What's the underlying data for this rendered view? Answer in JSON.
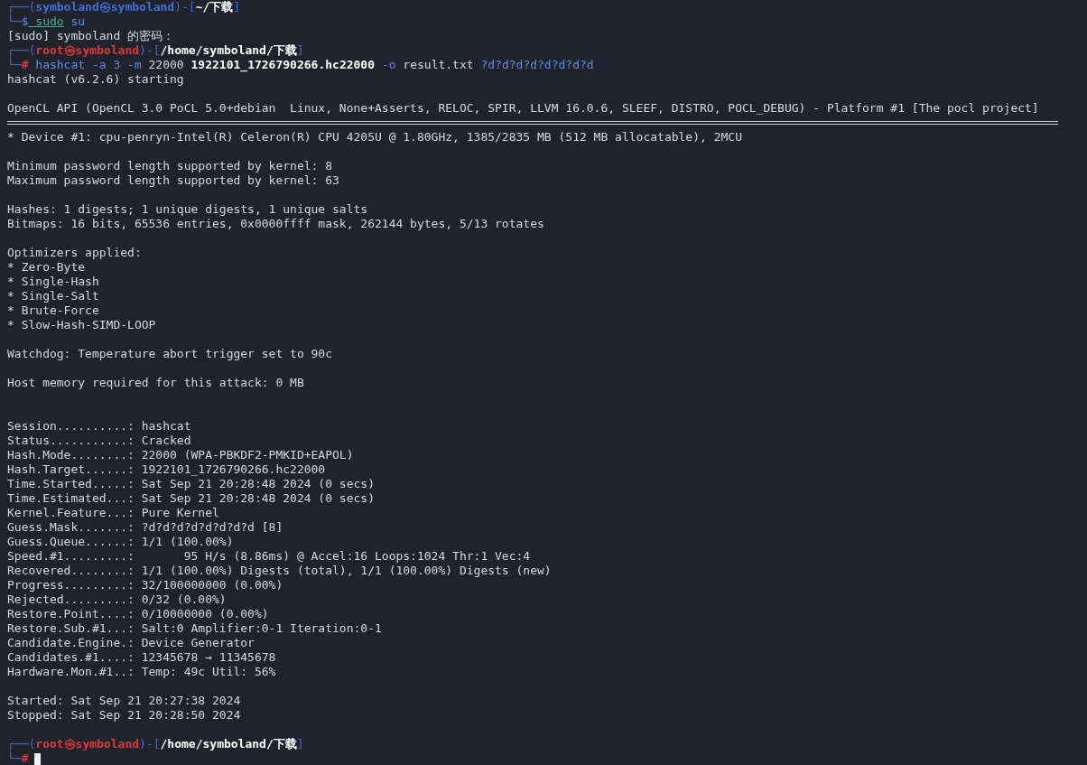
{
  "terminal": {
    "lines": [
      {
        "kind": "prompt",
        "segments": [
          {
            "text": "┌──(",
            "kind": "frame"
          },
          {
            "text": "symboland㉿symboland",
            "kind": "user"
          },
          {
            "text": ")-[",
            "kind": "frame"
          },
          {
            "text": "~/下载",
            "kind": "path"
          },
          {
            "text": "]",
            "kind": "frame"
          }
        ]
      },
      {
        "kind": "prompt",
        "segments": [
          {
            "text": "└─",
            "kind": "frame"
          },
          {
            "text": "$",
            "kind": "user"
          },
          {
            "text": " sudo",
            "kind": "underlined"
          },
          {
            "text": " su",
            "kind": "command"
          }
        ]
      },
      {
        "kind": "output",
        "segments": [
          {
            "text": "[sudo] symboland 的密码：",
            "kind": "plain"
          }
        ]
      },
      {
        "kind": "prompt",
        "segments": [
          {
            "text": "┌──(",
            "kind": "frame"
          },
          {
            "text": "root㉿symboland",
            "kind": "root"
          },
          {
            "text": ")-[",
            "kind": "frame"
          },
          {
            "text": "/home/symboland/下载",
            "kind": "path"
          },
          {
            "text": "]",
            "kind": "frame"
          }
        ]
      },
      {
        "kind": "prompt",
        "segments": [
          {
            "text": "└─",
            "kind": "frame"
          },
          {
            "text": "#",
            "kind": "root"
          },
          {
            "text": " hashcat -a 3 -m ",
            "kind": "command"
          },
          {
            "text": "22000 ",
            "kind": "plain"
          },
          {
            "text": "1922101_1726790266.hc22000",
            "kind": "bold"
          },
          {
            "text": " -o ",
            "kind": "command"
          },
          {
            "text": "result.txt ",
            "kind": "plain"
          },
          {
            "text": "?d?d?d?d?d?d?d?d",
            "kind": "command"
          }
        ]
      },
      {
        "kind": "output",
        "segments": [
          {
            "text": "hashcat (v6.2.6) starting",
            "kind": "plain"
          }
        ]
      },
      {
        "kind": "blank"
      },
      {
        "kind": "output",
        "segments": [
          {
            "text": "OpenCL API (OpenCL 3.0 PoCL 5.0+debian  Linux, None+Asserts, RELOC, SPIR, LLVM 16.0.6, SLEEF, DISTRO, POCL_DEBUG) - Platform #1 [The pocl project]",
            "kind": "plain"
          }
        ]
      },
      {
        "kind": "rule"
      },
      {
        "kind": "output",
        "segments": [
          {
            "text": "* Device #1: cpu-penryn-Intel(R) Celeron(R) CPU 4205U @ 1.80GHz, 1385/2835 MB (512 MB allocatable), 2MCU",
            "kind": "plain"
          }
        ]
      },
      {
        "kind": "blank"
      },
      {
        "kind": "output",
        "segments": [
          {
            "text": "Minimum password length supported by kernel: 8",
            "kind": "plain"
          }
        ]
      },
      {
        "kind": "output",
        "segments": [
          {
            "text": "Maximum password length supported by kernel: 63",
            "kind": "plain"
          }
        ]
      },
      {
        "kind": "blank"
      },
      {
        "kind": "output",
        "segments": [
          {
            "text": "Hashes: 1 digests; 1 unique digests, 1 unique salts",
            "kind": "plain"
          }
        ]
      },
      {
        "kind": "output",
        "segments": [
          {
            "text": "Bitmaps: 16 bits, 65536 entries, 0x0000ffff mask, 262144 bytes, 5/13 rotates",
            "kind": "plain"
          }
        ]
      },
      {
        "kind": "blank"
      },
      {
        "kind": "output",
        "segments": [
          {
            "text": "Optimizers applied:",
            "kind": "plain"
          }
        ]
      },
      {
        "kind": "output",
        "segments": [
          {
            "text": "* Zero-Byte",
            "kind": "plain"
          }
        ]
      },
      {
        "kind": "output",
        "segments": [
          {
            "text": "* Single-Hash",
            "kind": "plain"
          }
        ]
      },
      {
        "kind": "output",
        "segments": [
          {
            "text": "* Single-Salt",
            "kind": "plain"
          }
        ]
      },
      {
        "kind": "output",
        "segments": [
          {
            "text": "* Brute-Force",
            "kind": "plain"
          }
        ]
      },
      {
        "kind": "output",
        "segments": [
          {
            "text": "* Slow-Hash-SIMD-LOOP",
            "kind": "plain"
          }
        ]
      },
      {
        "kind": "blank"
      },
      {
        "kind": "output",
        "segments": [
          {
            "text": "Watchdog: Temperature abort trigger set to 90c",
            "kind": "plain"
          }
        ]
      },
      {
        "kind": "blank"
      },
      {
        "kind": "output",
        "segments": [
          {
            "text": "Host memory required for this attack: 0 MB",
            "kind": "plain"
          }
        ]
      },
      {
        "kind": "blank"
      },
      {
        "kind": "blank"
      },
      {
        "kind": "output",
        "segments": [
          {
            "text": "Session..........: hashcat",
            "kind": "plain"
          }
        ]
      },
      {
        "kind": "output",
        "segments": [
          {
            "text": "Status...........: Cracked",
            "kind": "plain"
          }
        ]
      },
      {
        "kind": "output",
        "segments": [
          {
            "text": "Hash.Mode........: 22000 (WPA-PBKDF2-PMKID+EAPOL)",
            "kind": "plain"
          }
        ]
      },
      {
        "kind": "output",
        "segments": [
          {
            "text": "Hash.Target......: 1922101_1726790266.hc22000",
            "kind": "plain"
          }
        ]
      },
      {
        "kind": "output",
        "segments": [
          {
            "text": "Time.Started.....: Sat Sep 21 20:28:48 2024 (0 secs)",
            "kind": "plain"
          }
        ]
      },
      {
        "kind": "output",
        "segments": [
          {
            "text": "Time.Estimated...: Sat Sep 21 20:28:48 2024 (0 secs)",
            "kind": "plain"
          }
        ]
      },
      {
        "kind": "output",
        "segments": [
          {
            "text": "Kernel.Feature...: Pure Kernel",
            "kind": "plain"
          }
        ]
      },
      {
        "kind": "output",
        "segments": [
          {
            "text": "Guess.Mask.......: ?d?d?d?d?d?d?d?d [8]",
            "kind": "plain"
          }
        ]
      },
      {
        "kind": "output",
        "segments": [
          {
            "text": "Guess.Queue......: 1/1 (100.00%)",
            "kind": "plain"
          }
        ]
      },
      {
        "kind": "output",
        "segments": [
          {
            "text": "Speed.#1.........:       95 H/s (8.86ms) @ Accel:16 Loops:1024 Thr:1 Vec:4",
            "kind": "plain"
          }
        ]
      },
      {
        "kind": "output",
        "segments": [
          {
            "text": "Recovered........: 1/1 (100.00%) Digests (total), 1/1 (100.00%) Digests (new)",
            "kind": "plain"
          }
        ]
      },
      {
        "kind": "output",
        "segments": [
          {
            "text": "Progress.........: 32/100000000 (0.00%)",
            "kind": "plain"
          }
        ]
      },
      {
        "kind": "output",
        "segments": [
          {
            "text": "Rejected.........: 0/32 (0.00%)",
            "kind": "plain"
          }
        ]
      },
      {
        "kind": "output",
        "segments": [
          {
            "text": "Restore.Point....: 0/10000000 (0.00%)",
            "kind": "plain"
          }
        ]
      },
      {
        "kind": "output",
        "segments": [
          {
            "text": "Restore.Sub.#1...: Salt:0 Amplifier:0-1 Iteration:0-1",
            "kind": "plain"
          }
        ]
      },
      {
        "kind": "output",
        "segments": [
          {
            "text": "Candidate.Engine.: Device Generator",
            "kind": "plain"
          }
        ]
      },
      {
        "kind": "output",
        "segments": [
          {
            "text": "Candidates.#1....: 12345678 → 11345678",
            "kind": "plain"
          }
        ]
      },
      {
        "kind": "output",
        "segments": [
          {
            "text": "Hardware.Mon.#1..: Temp: 49c Util: 56%",
            "kind": "plain"
          }
        ]
      },
      {
        "kind": "blank"
      },
      {
        "kind": "output",
        "segments": [
          {
            "text": "Started: Sat Sep 21 20:27:38 2024",
            "kind": "plain"
          }
        ]
      },
      {
        "kind": "output",
        "segments": [
          {
            "text": "Stopped: Sat Sep 21 20:28:50 2024",
            "kind": "plain"
          }
        ]
      },
      {
        "kind": "blank"
      },
      {
        "kind": "prompt",
        "segments": [
          {
            "text": "┌──(",
            "kind": "frame"
          },
          {
            "text": "root㉿symboland",
            "kind": "root"
          },
          {
            "text": ")-[",
            "kind": "frame"
          },
          {
            "text": "/home/symboland/下载",
            "kind": "path"
          },
          {
            "text": "]",
            "kind": "frame"
          }
        ]
      },
      {
        "kind": "prompt",
        "cursor": true,
        "segments": [
          {
            "text": "└─",
            "kind": "frame"
          },
          {
            "text": "#",
            "kind": "root"
          }
        ]
      }
    ]
  }
}
